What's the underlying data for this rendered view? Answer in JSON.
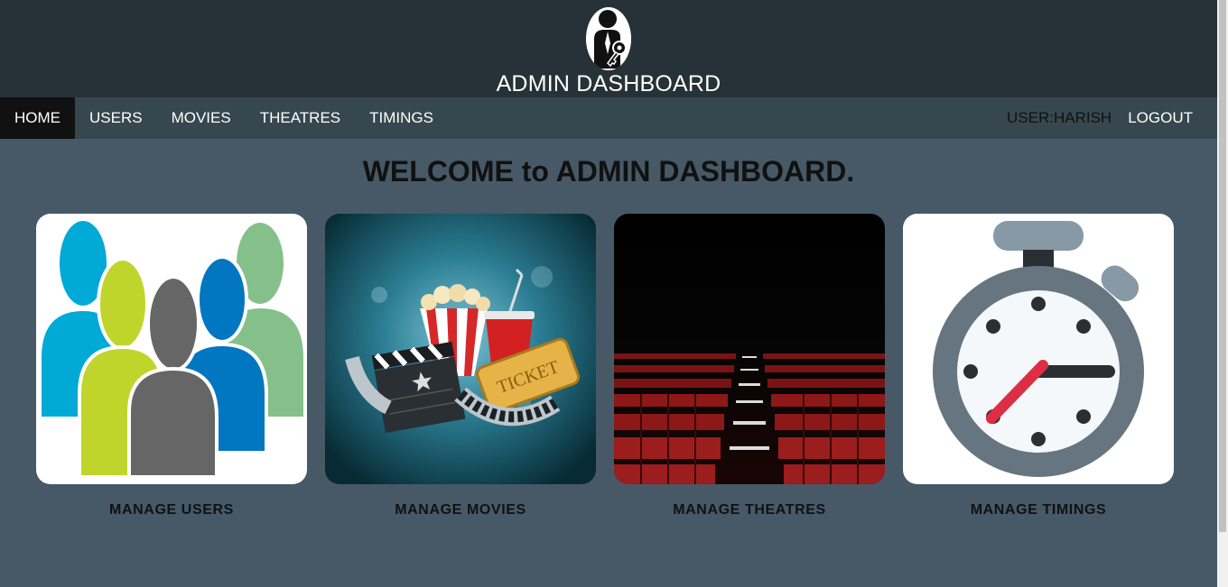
{
  "header": {
    "title": "ADMIN DASHBOARD",
    "logo_icon": "admin-key-icon"
  },
  "nav": {
    "items": [
      {
        "label": "HOME",
        "active": true
      },
      {
        "label": "USERS",
        "active": false
      },
      {
        "label": "MOVIES",
        "active": false
      },
      {
        "label": "THEATRES",
        "active": false
      },
      {
        "label": "TIMINGS",
        "active": false
      }
    ],
    "user_label": "USER:HARISH",
    "logout_label": "LOGOUT"
  },
  "main": {
    "welcome": "WELCOME to ADMIN DASHBOARD.",
    "cards": [
      {
        "label": "MANAGE USERS",
        "icon": "users-group-icon"
      },
      {
        "label": "MANAGE MOVIES",
        "icon": "movies-popcorn-icon",
        "ticket_text": "TICKET"
      },
      {
        "label": "MANAGE THEATRES",
        "icon": "theatre-seats-icon"
      },
      {
        "label": "MANAGE TIMINGS",
        "icon": "stopwatch-icon"
      }
    ]
  },
  "colors": {
    "header_bg": "#263138",
    "nav_bg": "#37474f",
    "page_bg": "#475966",
    "active_nav_bg": "#111111"
  }
}
